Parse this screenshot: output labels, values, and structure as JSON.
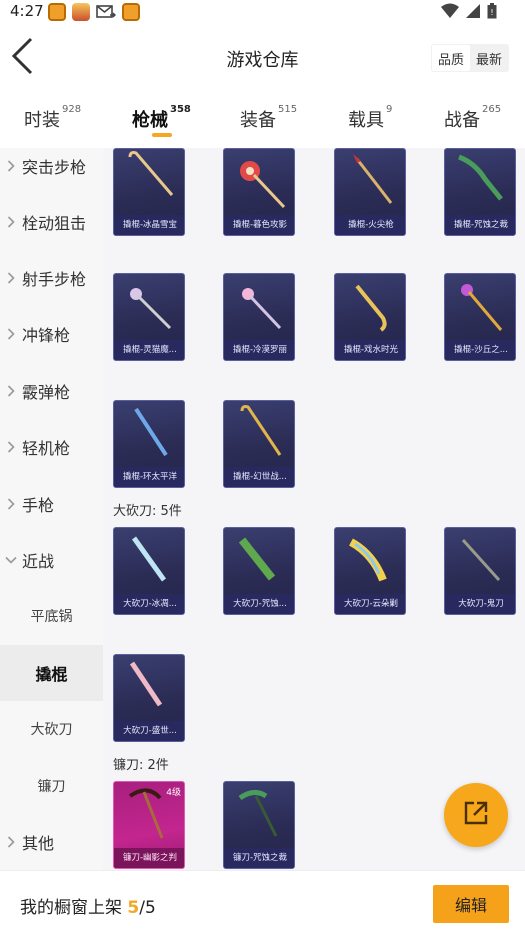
{
  "status_bar": {
    "time": "4:27",
    "left_icons": [
      "app-icon-1",
      "app-icon-2",
      "mail-icon",
      "app-icon-3"
    ],
    "right_icons": [
      "wifi-icon",
      "signal-icon",
      "battery-icon"
    ]
  },
  "header": {
    "title": "游戏仓库",
    "sort_options": [
      "品质",
      "最新"
    ],
    "sort_active": "品质"
  },
  "tabs": [
    {
      "label": "时装",
      "count": "928"
    },
    {
      "label": "枪械",
      "count": "358",
      "active": true
    },
    {
      "label": "装备",
      "count": "515"
    },
    {
      "label": "载具",
      "count": "9"
    },
    {
      "label": "战备",
      "count": "265"
    }
  ],
  "sidebar": {
    "items": [
      {
        "label": "突击步枪"
      },
      {
        "label": "栓动狙击"
      },
      {
        "label": "射手步枪"
      },
      {
        "label": "冲锋枪"
      },
      {
        "label": "霰弹枪"
      },
      {
        "label": "轻机枪"
      },
      {
        "label": "手枪"
      },
      {
        "label": "近战",
        "expanded": true
      }
    ],
    "sub_items": [
      {
        "label": "平底锅"
      },
      {
        "label": "撬棍",
        "active": true
      },
      {
        "label": "大砍刀"
      },
      {
        "label": "镰刀"
      }
    ],
    "last_item": {
      "label": "其他"
    }
  },
  "content": {
    "crowbar_row1": [
      "撬棍-冰晶雪宝",
      "撬棍-暮色攻影",
      "撬棍-火尖枪",
      "撬棍-咒蚀之裁"
    ],
    "crowbar_row2": [
      "撬棍-灵猫魔...",
      "撬棍-冷漠罗丽",
      "撬棍-戏水时光",
      "撬棍-沙丘之..."
    ],
    "crowbar_row3": [
      "撬棍-环太平洋",
      "撬棍-幻世战..."
    ],
    "machete_section": "大砍刀: 5件",
    "machete_row1": [
      "大砍刀-冰凋...",
      "大砍刀-咒蚀...",
      "大砍刀-云朵剿",
      "大砍刀-鬼刀"
    ],
    "machete_row2": [
      "大砍刀-盛世..."
    ],
    "sickle_section": "镰刀: 2件",
    "sickle_items": [
      {
        "label": "镰刀-幽影之判",
        "badge": "4级",
        "rarity": "pink"
      },
      {
        "label": "镰刀-咒蚀之裁",
        "rarity": "blue"
      }
    ]
  },
  "bottom_bar": {
    "prefix": "我的橱窗上架 ",
    "current": "5",
    "separator": "/",
    "total": "5",
    "edit_label": "编辑"
  },
  "colors": {
    "accent": "#f5a623",
    "card_bg": "#2b2c55",
    "card_pink": "#c3268f"
  }
}
